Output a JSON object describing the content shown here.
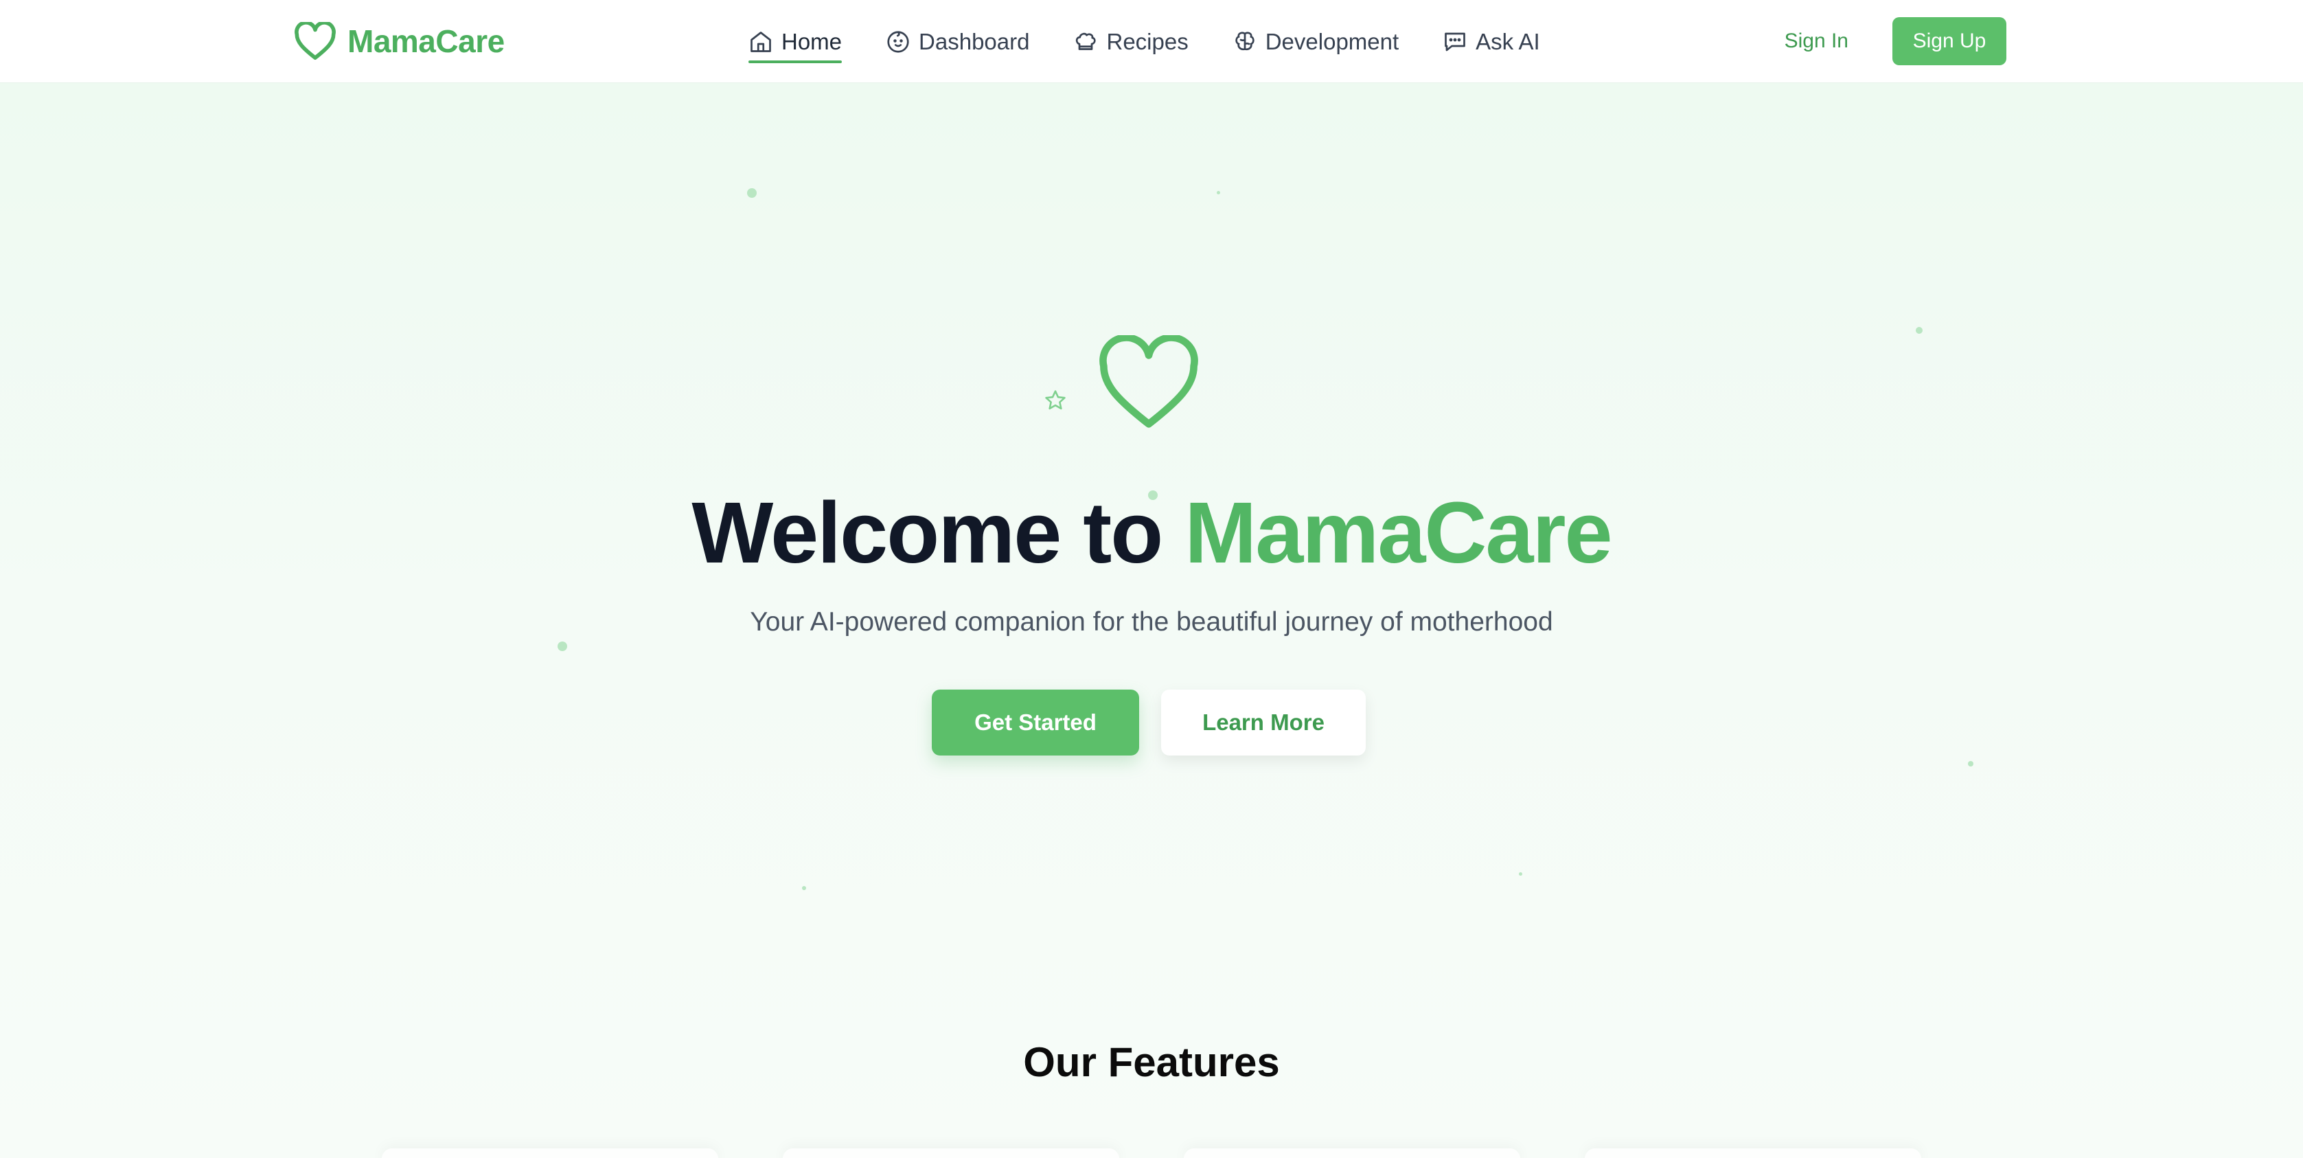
{
  "brand": {
    "name": "MamaCare",
    "accent": "#4caf5e"
  },
  "nav": {
    "items": [
      {
        "label": "Home",
        "icon": "home-icon",
        "active": true
      },
      {
        "label": "Dashboard",
        "icon": "baby-face-icon",
        "active": false
      },
      {
        "label": "Recipes",
        "icon": "chef-hat-icon",
        "active": false
      },
      {
        "label": "Development",
        "icon": "brain-icon",
        "active": false
      },
      {
        "label": "Ask AI",
        "icon": "chat-icon",
        "active": false
      }
    ]
  },
  "auth": {
    "signin_label": "Sign In",
    "signup_label": "Sign Up"
  },
  "hero": {
    "title_prefix": "Welcome to",
    "title_accent": "MamaCare",
    "subtitle": "Your AI-powered companion for the beautiful journey of motherhood",
    "primary_button": "Get Started",
    "secondary_button": "Learn More"
  },
  "features": {
    "title": "Our Features"
  }
}
